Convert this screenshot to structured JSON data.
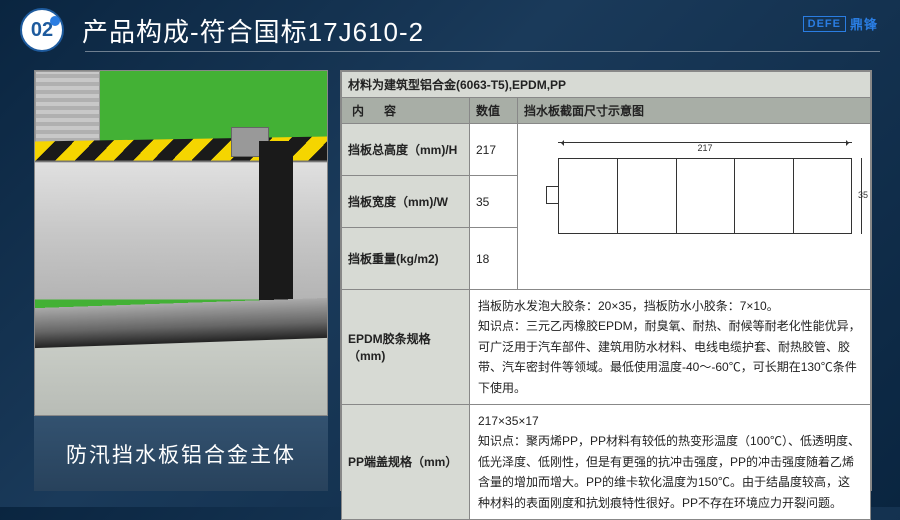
{
  "header": {
    "badge": "02",
    "title": "产品构成-符合国标17J610-2",
    "logo_box": "DEFE",
    "logo_text": "鼎锋"
  },
  "left": {
    "caption": "防汛挡水板铝合金主体"
  },
  "table": {
    "material": "材料为建筑型铝合金(6063-T5),EPDM,PP",
    "col_content": "内容",
    "col_value": "数值",
    "col_diagram": "挡水板截面尺寸示意图",
    "rows": [
      {
        "label": "挡板总高度（mm)/H",
        "value": "217"
      },
      {
        "label": "挡板宽度（mm)/W",
        "value": "35"
      },
      {
        "label": "挡板重量(kg/m2)",
        "value": "18"
      }
    ],
    "diagram": {
      "dim_w": "217",
      "dim_h": "35"
    },
    "epdm": {
      "label": "EPDM胶条规格（mm)",
      "line1": "挡板防水发泡大胶条：20×35，挡板防水小胶条：7×10。",
      "line2": "知识点：三元乙丙橡胶EPDM，耐臭氧、耐热、耐候等耐老化性能优异，可广泛用于汽车部件、建筑用防水材料、电线电缆护套、耐热胶管、胶带、汽车密封件等领域。最低使用温度-40～-60℃，可长期在130℃条件下使用。"
    },
    "pp": {
      "label": "PP端盖规格（mm）",
      "line1": "217×35×17",
      "line2": "知识点：聚丙烯PP，PP材料有较低的热变形温度（100℃）、低透明度、低光泽度、低刚性，但是有更强的抗冲击强度，PP的冲击强度随着乙烯含量的增加而增大。PP的维卡软化温度为150℃。由于结晶度较高，这种材料的表面刚度和抗划痕特性很好。PP不存在环境应力开裂问题。"
    }
  }
}
